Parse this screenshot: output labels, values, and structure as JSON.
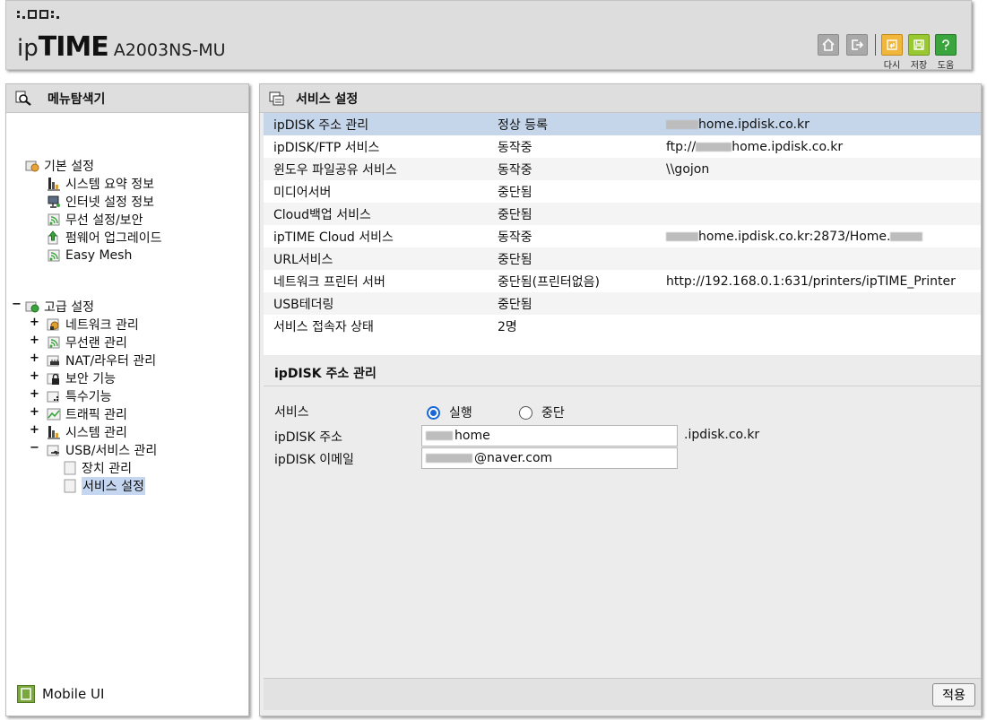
{
  "header": {
    "brand_ip": "ip",
    "brand_time": "TIME",
    "model": "A2003NS-MU",
    "buttons": [
      {
        "name": "home",
        "label": ""
      },
      {
        "name": "logout",
        "label": ""
      },
      {
        "name": "reload",
        "label": "다시"
      },
      {
        "name": "save",
        "label": "저장"
      },
      {
        "name": "help",
        "label": "도움"
      }
    ]
  },
  "sidebar": {
    "title": "메뉴탐색기",
    "basic": {
      "label": "기본 설정",
      "items": [
        "시스템 요약 정보",
        "인터넷 설정 정보",
        "무선 설정/보안",
        "펌웨어 업그레이드",
        "Easy Mesh"
      ]
    },
    "advanced": {
      "label": "고급 설정",
      "items": [
        "네트워크 관리",
        "무선랜 관리",
        "NAT/라우터 관리",
        "보안 기능",
        "특수기능",
        "트래픽 관리",
        "시스템 관리",
        "USB/서비스 관리"
      ],
      "usb_children": [
        "장치 관리",
        "서비스 설정"
      ]
    },
    "mobile_ui": "Mobile UI"
  },
  "main": {
    "title": "서비스 설정",
    "services": [
      {
        "name": "ipDISK 주소 관리",
        "status": "정상 등록",
        "info": "home.ipdisk.co.kr"
      },
      {
        "name": "ipDISK/FTP 서비스",
        "status": "동작중",
        "info_prefix": "ftp://",
        "info": "home.ipdisk.co.kr"
      },
      {
        "name": "윈도우 파일공유 서비스",
        "status": "동작중",
        "info": "\\\\gojon"
      },
      {
        "name": "미디어서버",
        "status": "중단됨",
        "info": ""
      },
      {
        "name": "Cloud백업 서비스",
        "status": "중단됨",
        "info": ""
      },
      {
        "name": "ipTIME Cloud 서비스",
        "status": "동작중",
        "info": "home.ipdisk.co.kr:2873/Home."
      },
      {
        "name": "URL서비스",
        "status": "중단됨",
        "info": ""
      },
      {
        "name": "네트워크 프린터 서버",
        "status": "중단됨(프린터없음)",
        "info": "http://192.168.0.1:631/printers/ipTIME_Printer"
      },
      {
        "name": "USB테더링",
        "status": "중단됨",
        "info": ""
      },
      {
        "name": "서비스 접속자 상태",
        "status": "2명",
        "info": ""
      }
    ],
    "section_title": "ipDISK 주소 관리",
    "form": {
      "service_label": "서비스",
      "run_label": "실행",
      "stop_label": "중단",
      "selected": "run",
      "address_label": "ipDISK 주소",
      "address_value": "home",
      "address_suffix": ".ipdisk.co.kr",
      "email_label": "ipDISK 이메일",
      "email_value": "@naver.com"
    },
    "apply": "적용"
  }
}
